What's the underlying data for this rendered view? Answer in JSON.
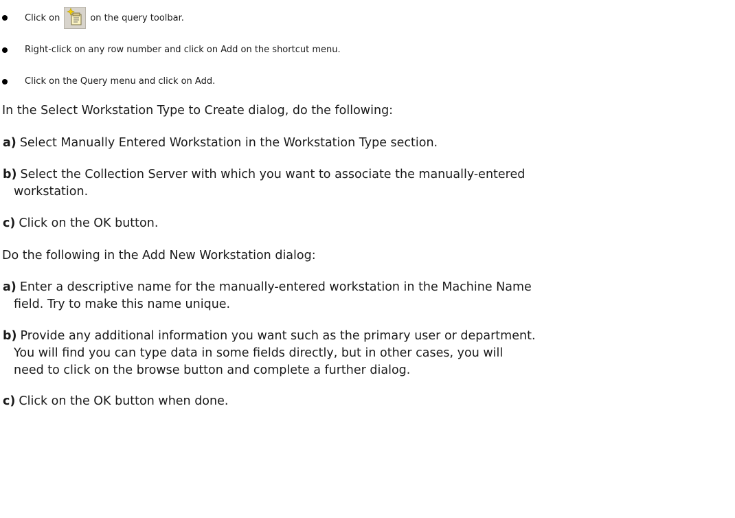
{
  "bullets": [
    {
      "before": "Click on",
      "icon": "new-query-icon",
      "after": "on the query toolbar."
    },
    {
      "text": "Right-click on any row number and click on Add on the shortcut menu."
    },
    {
      "text": "Click on the Query menu and click on Add."
    }
  ],
  "section1": {
    "intro": "In the Select Workstation Type to Create dialog, do the following:",
    "steps": [
      {
        "label": "a)",
        "line1": "Select Manually Entered Workstation in the Workstation Type section."
      },
      {
        "label": "b)",
        "line1": "Select the Collection Server with which you want to associate the manually-entered",
        "line2": "workstation."
      },
      {
        "label": "c)",
        "line1": "Click on the OK button."
      }
    ]
  },
  "section2": {
    "intro": "Do the following in the Add New Workstation dialog:",
    "steps": [
      {
        "label": "a)",
        "line1": "Enter a descriptive name for the manually-entered workstation in the Machine Name",
        "line2": "field. Try to make this name unique."
      },
      {
        "label": "b)",
        "line1": "Provide any additional information you want such as the primary user or department.",
        "line2": "You will find you can type data in some fields directly, but in other cases, you will",
        "line3": "need to click on the browse button and complete a further dialog."
      },
      {
        "label": "c)",
        "line1": "Click on the OK button when done."
      }
    ]
  }
}
